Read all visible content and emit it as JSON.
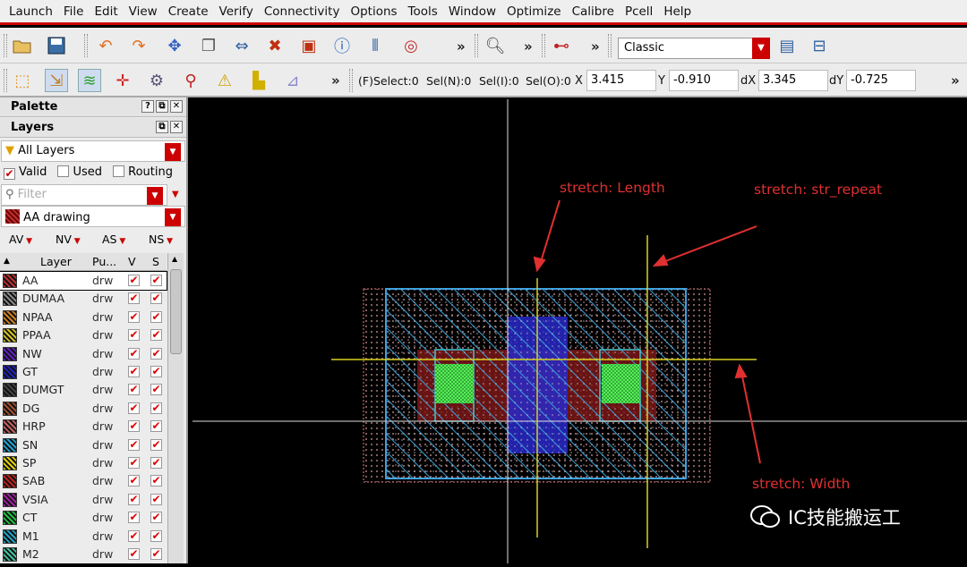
{
  "menu": [
    "Launch",
    "File",
    "Edit",
    "View",
    "Create",
    "Verify",
    "Connectivity",
    "Options",
    "Tools",
    "Window",
    "Optimize",
    "Calibre",
    "Pcell",
    "Help"
  ],
  "toolbar": {
    "workspace": "Classic",
    "overflow": "»"
  },
  "status": {
    "select_f": "(F)Select:0",
    "sel_n": "Sel(N):0",
    "sel_i": "Sel(I):0",
    "sel_o": "Sel(O):0",
    "x_label": "X",
    "x_value": "3.415",
    "y_label": "Y",
    "y_value": "-0.910",
    "dx_label": "dX",
    "dx_value": "3.345",
    "dy_label": "dY",
    "dy_value": "-0.725"
  },
  "palette": {
    "title": "Palette",
    "layers_title": "Layers",
    "filter_set": "All Layers",
    "valid_label": "Valid",
    "used_label": "Used",
    "routing_label": "Routing",
    "filter_placeholder": "Filter",
    "current_layer": "AA drawing",
    "vis_toggles": [
      "AV",
      "NV",
      "AS",
      "NS"
    ],
    "columns": {
      "layer": "Layer",
      "purpose": "Pu...",
      "v": "V",
      "s": "S"
    },
    "layers": [
      {
        "name": "AA",
        "purpose": "drw",
        "color": "#c03030"
      },
      {
        "name": "DUMAA",
        "purpose": "drw",
        "color": "#888888"
      },
      {
        "name": "NPAA",
        "purpose": "drw",
        "color": "#d08020"
      },
      {
        "name": "PPAA",
        "purpose": "drw",
        "color": "#d0c020"
      },
      {
        "name": "NW",
        "purpose": "drw",
        "color": "#6020c0"
      },
      {
        "name": "GT",
        "purpose": "drw",
        "color": "#2020c0"
      },
      {
        "name": "DUMGT",
        "purpose": "drw",
        "color": "#444444"
      },
      {
        "name": "DG",
        "purpose": "drw",
        "color": "#a05030"
      },
      {
        "name": "HRP",
        "purpose": "drw",
        "color": "#c06060"
      },
      {
        "name": "SN",
        "purpose": "drw",
        "color": "#20a0d0"
      },
      {
        "name": "SP",
        "purpose": "drw",
        "color": "#e0d000"
      },
      {
        "name": "SAB",
        "purpose": "drw",
        "color": "#c02020"
      },
      {
        "name": "VSIA",
        "purpose": "drw",
        "color": "#a020a0"
      },
      {
        "name": "CT",
        "purpose": "drw",
        "color": "#20c040"
      },
      {
        "name": "M1",
        "purpose": "drw",
        "color": "#20a0c0"
      },
      {
        "name": "M2",
        "purpose": "drw",
        "color": "#40c0a0"
      }
    ]
  },
  "annotations": {
    "length": "stretch: Length",
    "repeat": "stretch: str_repeat",
    "width": "stretch: Width"
  },
  "watermark": "IC技能搬运工"
}
